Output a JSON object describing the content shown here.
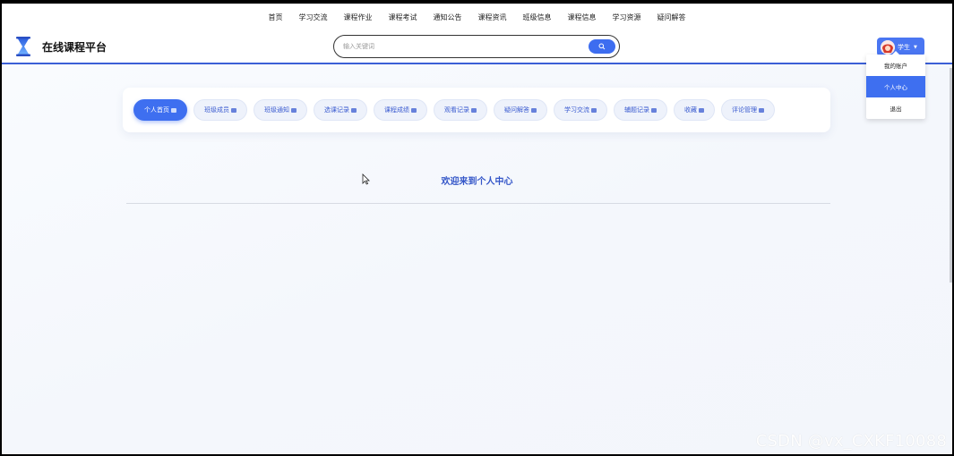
{
  "top_nav": [
    "首页",
    "学习交流",
    "课程作业",
    "课程考试",
    "通知公告",
    "课程资讯",
    "班级信息",
    "课程信息",
    "学习资源",
    "疑问解答"
  ],
  "site": {
    "title": "在线课程平台"
  },
  "search": {
    "placeholder": "输入关键词"
  },
  "user": {
    "label": "学生",
    "menu": [
      "我的账户",
      "个人中心",
      "退出"
    ],
    "active_menu_index": 1
  },
  "tabs": [
    "个人首页",
    "班级成员",
    "班级通知",
    "选课记录",
    "课程成绩",
    "观看记录",
    "疑问解答",
    "学习交流",
    "辅题记录",
    "收藏",
    "评论管理"
  ],
  "active_tab_index": 0,
  "main": {
    "welcome": "欢迎来到个人中心"
  },
  "watermark": "CSDN @vx_CXKF10088",
  "colors": {
    "accent": "#3e6ff0",
    "header_border": "#3b5fd6",
    "welcome_text": "#3456c8"
  },
  "icons": {
    "logo": "hourglass-logo-icon",
    "search": "search-icon",
    "tab": "briefcase-icon"
  }
}
